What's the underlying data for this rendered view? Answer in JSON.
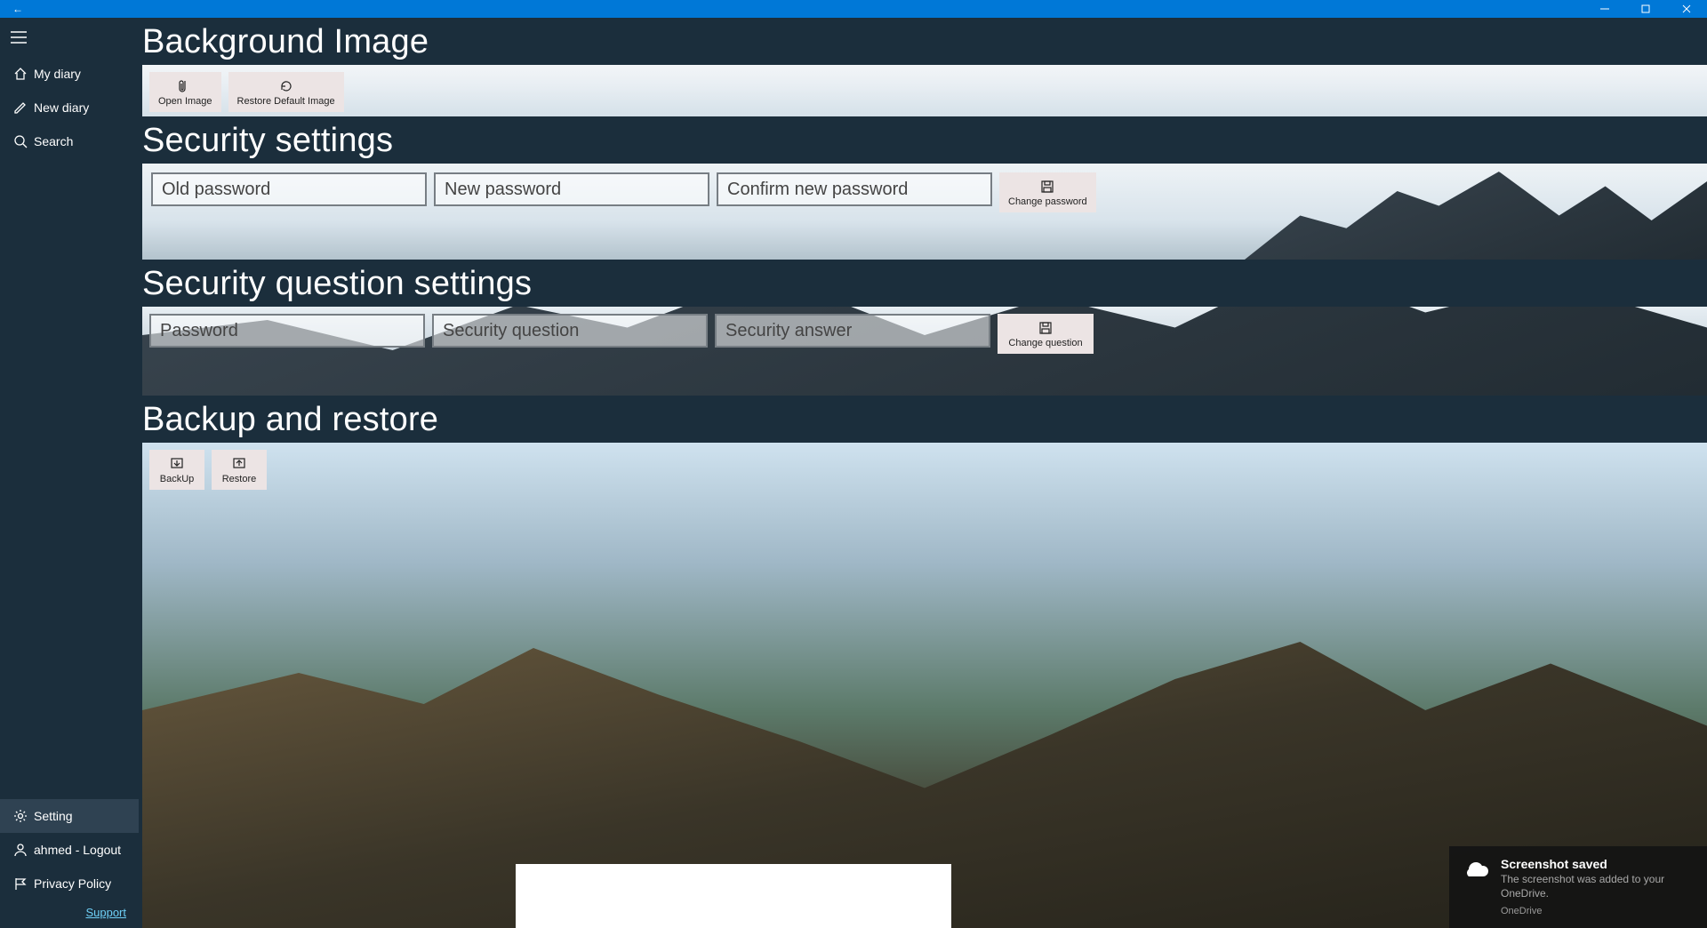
{
  "titlebar": {
    "back_label": "←"
  },
  "sidebar": {
    "items": [
      {
        "label": "My diary"
      },
      {
        "label": "New diary"
      },
      {
        "label": "Search"
      },
      {
        "label": "Setting"
      },
      {
        "label": "ahmed - Logout"
      },
      {
        "label": "Privacy Policy"
      }
    ],
    "support_label": "Support"
  },
  "sections": {
    "background_image": {
      "title": "Background Image",
      "open_image": "Open Image",
      "restore_default": "Restore Default Image"
    },
    "security_settings": {
      "title": "Security settings",
      "old_password_ph": "Old password",
      "new_password_ph": "New password",
      "confirm_password_ph": "Confirm new password",
      "change_password": "Change password"
    },
    "security_question": {
      "title": "Security question settings",
      "password_ph": "Password",
      "question_ph": "Security question",
      "answer_ph": "Security answer",
      "change_question": "Change question"
    },
    "backup_restore": {
      "title": "Backup and restore",
      "backup": "BackUp",
      "restore": "Restore"
    }
  },
  "toast": {
    "title": "Screenshot saved",
    "message": "The screenshot was added to your OneDrive.",
    "source": "OneDrive"
  }
}
